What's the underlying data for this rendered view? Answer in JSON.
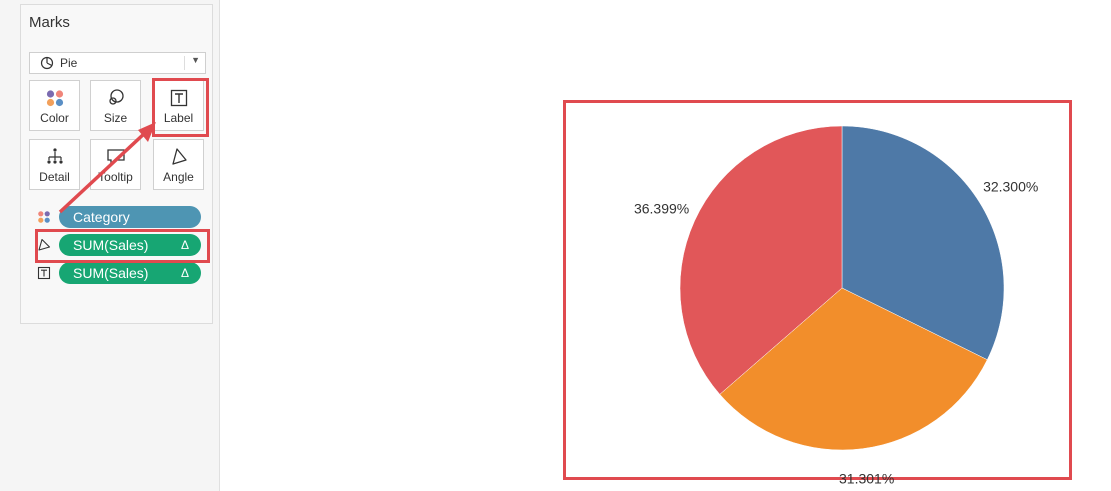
{
  "marks_card": {
    "title": "Marks",
    "mark_type": {
      "selected": "Pie",
      "icon": "pie-icon"
    },
    "tiles": [
      {
        "label": "Color",
        "icon": "color-dots-icon"
      },
      {
        "label": "Size",
        "icon": "size-icon"
      },
      {
        "label": "Label",
        "icon": "label-text-icon"
      },
      {
        "label": "Detail",
        "icon": "detail-icon"
      },
      {
        "label": "Tooltip",
        "icon": "tooltip-icon"
      },
      {
        "label": "Angle",
        "icon": "angle-icon"
      }
    ],
    "shelf": [
      {
        "type": "color",
        "icon": "color-dots-icon",
        "pill": "Category",
        "pill_color": "#4e95b3",
        "delta": ""
      },
      {
        "type": "angle",
        "icon": "angle-icon",
        "pill": "SUM(Sales)",
        "pill_color": "#17a673",
        "delta": "Δ"
      },
      {
        "type": "label",
        "icon": "label-text-icon",
        "pill": "SUM(Sales)",
        "pill_color": "#17a673",
        "delta": "Δ"
      }
    ]
  },
  "annotation_color": "#e04a4f",
  "chart_data": {
    "type": "pie",
    "slices": [
      {
        "label": "32.300%",
        "value": 32.3,
        "color": "#4e79a7"
      },
      {
        "label": "31.301%",
        "value": 31.301,
        "color": "#f28e2b"
      },
      {
        "label": "36.399%",
        "value": 36.399,
        "color": "#e15759"
      }
    ]
  }
}
